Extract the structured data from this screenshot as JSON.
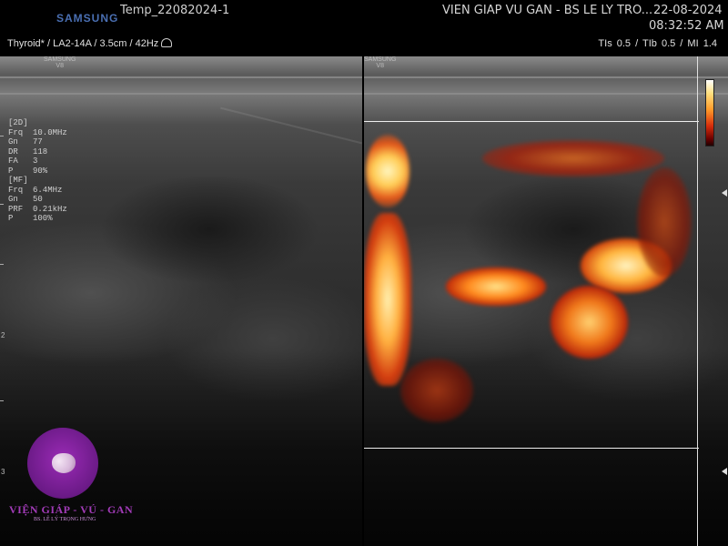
{
  "header": {
    "brand": "SAMSUNG",
    "patient_id": "Temp_22082024-1",
    "institution": "VIEN GIAP VU GAN - BS LE LY TRO...",
    "date": "22-08-2024",
    "time": "08:32:52 AM",
    "preset": "Thyroid* / LA2-14A / 3.5cm / 42Hz",
    "indices": "TIs 0.5 / TIb 0.5 / MI  1.4"
  },
  "probe_logo": {
    "brand": "SAMSUNG",
    "model": "V8"
  },
  "params_2d": {
    "mode": "[2D]",
    "rows": [
      {
        "k": "Frq",
        "v": "10.0MHz"
      },
      {
        "k": "Gn",
        "v": "77"
      },
      {
        "k": "DR",
        "v": "118"
      },
      {
        "k": "FA",
        "v": "3"
      },
      {
        "k": "P",
        "v": "90%"
      }
    ]
  },
  "params_mf": {
    "mode": "[MF]",
    "rows": [
      {
        "k": "Frq",
        "v": "6.4MHz"
      },
      {
        "k": "Gn",
        "v": "50"
      },
      {
        "k": "PRF",
        "v": "0.21kHz"
      },
      {
        "k": "P",
        "v": "100%"
      }
    ]
  },
  "depth_ticks": [
    "1",
    "2",
    "3"
  ],
  "watermark": {
    "name": "VIỆN GIÁP - VÚ - GAN",
    "doctor": "BS. LÊ LÝ TRỌNG HƯNG"
  },
  "colors": {
    "background": "#000000",
    "doppler_hot": "#ff9b2a",
    "doppler_core": "#fff2b0",
    "watermark": "#a23bb8"
  },
  "icons": [
    "probe-icon",
    "thyroid-logo-icon",
    "colorbar-icon"
  ]
}
